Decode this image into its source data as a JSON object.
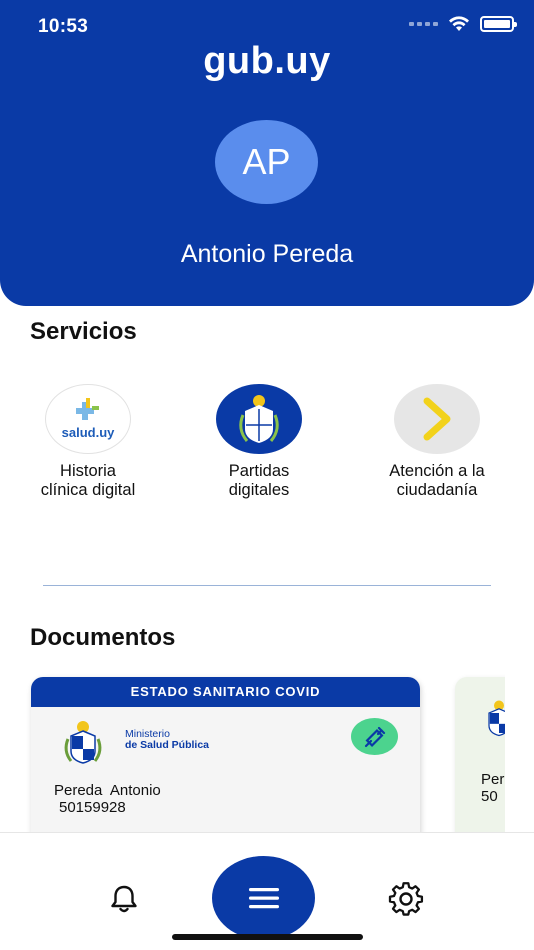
{
  "status_bar": {
    "time": "10:53"
  },
  "header": {
    "app_title": "gub.uy",
    "avatar_initials": "AP",
    "user_name": "Antonio Pereda"
  },
  "services": {
    "title": "Servicios",
    "items": [
      {
        "label_line1": "Historia",
        "label_line2": "clínica digital",
        "logo_text": "salud.uy",
        "icon": "salud-uy-logo"
      },
      {
        "label_line1": "Partidas",
        "label_line2": "digitales",
        "icon": "uruguay-coat-of-arms"
      },
      {
        "label_line1": "Atención a la",
        "label_line2": "ciudadanía",
        "icon": "chevron-right-icon"
      }
    ]
  },
  "documents": {
    "title": "Documentos",
    "cards": [
      {
        "header": "ESTADO SANITARIO COVID",
        "ministry_line1": "Ministerio",
        "ministry_line2": "de Salud Pública",
        "holder_name": "Pereda  Antonio",
        "holder_id": "50159928",
        "badge_icon": "syringe-icon"
      },
      {
        "holder_name_partial": "Per",
        "holder_id_partial": "50"
      }
    ]
  },
  "bottom_nav": {
    "left_icon": "bell-icon",
    "center_icon": "menu-icon",
    "right_icon": "gear-icon"
  },
  "colors": {
    "brand_blue": "#0a3aa6",
    "avatar_blue": "#5a8ded",
    "vaccine_green": "#4cd38e",
    "chevron_yellow": "#f2d21b"
  }
}
